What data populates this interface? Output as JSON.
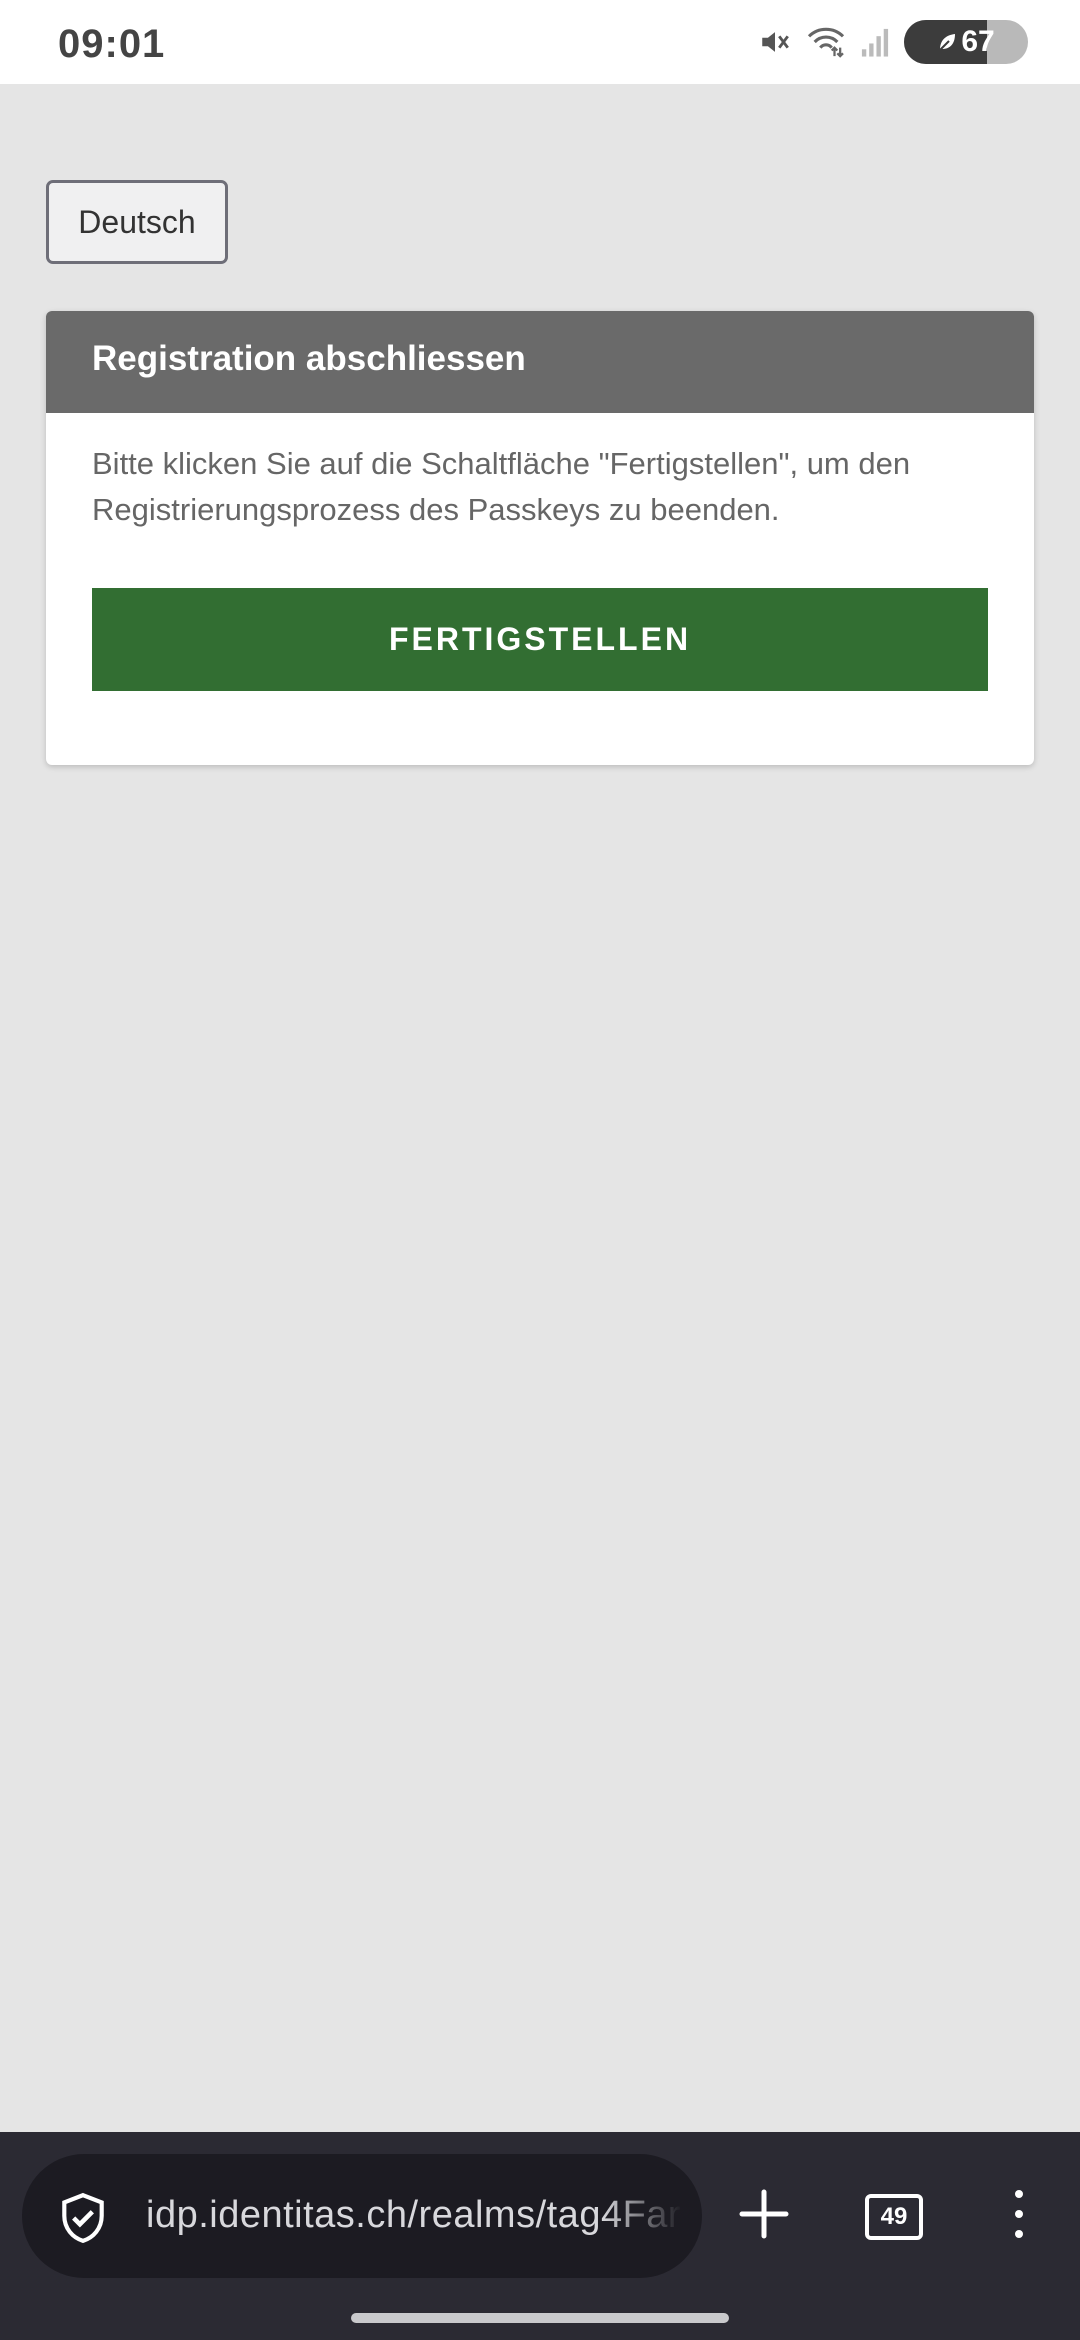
{
  "status_bar": {
    "time": "09:01",
    "battery_level": "67",
    "icons": [
      "mute-icon",
      "wifi-icon",
      "signal-icon",
      "battery-icon"
    ]
  },
  "language_selector": {
    "label": "Deutsch"
  },
  "card": {
    "title": "Registration abschliessen",
    "message": "Bitte klicken Sie auf die Schaltfläche \"Fertigstellen\", um den Registrierungsprozess des Passkeys zu beenden.",
    "button_label": "FERTIGSTELLEN"
  },
  "browser": {
    "url": "idp.identitas.ch/realms/tag4Far",
    "tab_count": "49",
    "icons": [
      "shield-check-icon",
      "plus-icon",
      "tabs-icon",
      "menu-kebab-icon"
    ]
  },
  "colors": {
    "page_background": "#e5e5e5",
    "card_header": "#6a6a6a",
    "primary_button": "#326e32",
    "browser_bar": "#2b2a33"
  }
}
